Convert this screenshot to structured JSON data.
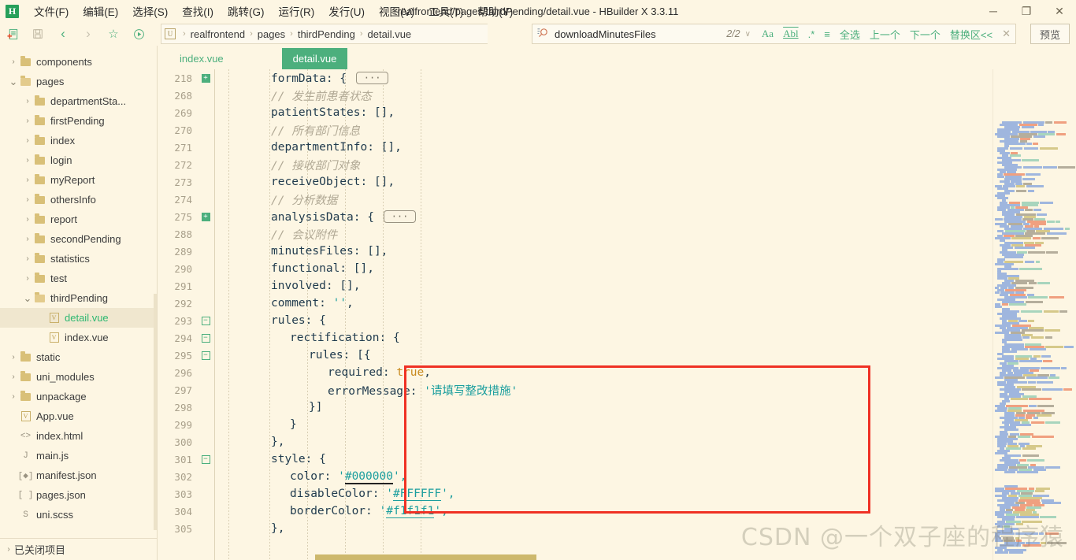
{
  "window": {
    "title": "realfrontend/pages/thirdPending/detail.vue - HBuilder X 3.3.11",
    "logo": "H",
    "minimize": "─",
    "maximize": "❐",
    "close": "✕"
  },
  "menubar": {
    "items": [
      {
        "label": "文件(F)",
        "name": "menu-file"
      },
      {
        "label": "编辑(E)",
        "name": "menu-edit"
      },
      {
        "label": "选择(S)",
        "name": "menu-select"
      },
      {
        "label": "查找(I)",
        "name": "menu-find"
      },
      {
        "label": "跳转(G)",
        "name": "menu-goto"
      },
      {
        "label": "运行(R)",
        "name": "menu-run"
      },
      {
        "label": "发行(U)",
        "name": "menu-publish"
      },
      {
        "label": "视图(V)",
        "name": "menu-view"
      },
      {
        "label": "工具(T)",
        "name": "menu-tools"
      },
      {
        "label": "帮助(Y)",
        "name": "menu-help"
      }
    ]
  },
  "toolbar": {
    "icons": [
      {
        "name": "new-file-icon",
        "glyph": "new"
      },
      {
        "name": "save-icon",
        "glyph": "save"
      },
      {
        "name": "back-arrow-icon",
        "glyph": "‹"
      },
      {
        "name": "forward-arrow-icon",
        "glyph": "›"
      },
      {
        "name": "star-icon",
        "glyph": "☆"
      },
      {
        "name": "run-icon",
        "glyph": "▶"
      }
    ],
    "breadcrumb": {
      "badge": "U",
      "separator": "›",
      "parts": [
        "realfrontend",
        "pages",
        "thirdPending",
        "detail.vue"
      ]
    },
    "preview_label": "预览"
  },
  "search": {
    "icon": "search-icon",
    "value": "downloadMinutesFiles",
    "count": "2/2",
    "chevron": "∨",
    "match_case": "Aa",
    "match_word": "Abl",
    "regex": ".*",
    "in_selection": "≡",
    "select_all": "全选",
    "prev": "上一个",
    "next": "下一个",
    "replace": "替换区<<",
    "close": "✕"
  },
  "sidebar": {
    "items": [
      {
        "label": "components",
        "indent": 1,
        "type": "folder",
        "arrow": "closed",
        "selected": false
      },
      {
        "label": "pages",
        "indent": 1,
        "type": "folder-open",
        "arrow": "open",
        "selected": false
      },
      {
        "label": "departmentSta...",
        "indent": 2,
        "type": "folder",
        "arrow": "closed",
        "selected": false
      },
      {
        "label": "firstPending",
        "indent": 2,
        "type": "folder",
        "arrow": "closed",
        "selected": false
      },
      {
        "label": "index",
        "indent": 2,
        "type": "folder",
        "arrow": "closed",
        "selected": false
      },
      {
        "label": "login",
        "indent": 2,
        "type": "folder",
        "arrow": "closed",
        "selected": false
      },
      {
        "label": "myReport",
        "indent": 2,
        "type": "folder",
        "arrow": "closed",
        "selected": false
      },
      {
        "label": "othersInfo",
        "indent": 2,
        "type": "folder",
        "arrow": "closed",
        "selected": false
      },
      {
        "label": "report",
        "indent": 2,
        "type": "folder",
        "arrow": "closed",
        "selected": false
      },
      {
        "label": "secondPending",
        "indent": 2,
        "type": "folder",
        "arrow": "closed",
        "selected": false
      },
      {
        "label": "statistics",
        "indent": 2,
        "type": "folder",
        "arrow": "closed",
        "selected": false
      },
      {
        "label": "test",
        "indent": 2,
        "type": "folder",
        "arrow": "closed",
        "selected": false
      },
      {
        "label": "thirdPending",
        "indent": 2,
        "type": "folder-open",
        "arrow": "open",
        "selected": false
      },
      {
        "label": "detail.vue",
        "indent": 3,
        "type": "vue",
        "arrow": "none",
        "selected": true,
        "active": true
      },
      {
        "label": "index.vue",
        "indent": 3,
        "type": "vue",
        "arrow": "none",
        "selected": false
      },
      {
        "label": "static",
        "indent": 1,
        "type": "folder",
        "arrow": "closed",
        "selected": false
      },
      {
        "label": "uni_modules",
        "indent": 1,
        "type": "folder",
        "arrow": "closed",
        "selected": false
      },
      {
        "label": "unpackage",
        "indent": 1,
        "type": "folder",
        "arrow": "closed",
        "selected": false
      },
      {
        "label": "App.vue",
        "indent": 1,
        "type": "vue",
        "arrow": "none",
        "selected": false
      },
      {
        "label": "index.html",
        "indent": 1,
        "type": "html",
        "arrow": "none",
        "selected": false
      },
      {
        "label": "main.js",
        "indent": 1,
        "type": "js",
        "arrow": "none",
        "selected": false
      },
      {
        "label": "manifest.json",
        "indent": 1,
        "type": "manifest",
        "arrow": "none",
        "selected": false
      },
      {
        "label": "pages.json",
        "indent": 1,
        "type": "json",
        "arrow": "none",
        "selected": false
      },
      {
        "label": "uni.scss",
        "indent": 1,
        "type": "scss",
        "arrow": "none",
        "selected": false
      }
    ],
    "closed_projects": "已关闭项目",
    "closed_arrow": "›"
  },
  "tabs": [
    {
      "label": "index.vue",
      "active": false
    },
    {
      "label": "detail.vue",
      "active": true
    }
  ],
  "editor": {
    "lines": [
      {
        "num": "218",
        "fold": "plus",
        "indent": 4,
        "parts": [
          {
            "t": "formData: { ",
            "c": "code-txt"
          },
          {
            "t": "···",
            "c": "pill"
          }
        ]
      },
      {
        "num": "268",
        "fold": "",
        "indent": 4,
        "parts": [
          {
            "t": "// 发生前患者状态",
            "c": "cmt"
          }
        ]
      },
      {
        "num": "269",
        "fold": "",
        "indent": 4,
        "parts": [
          {
            "t": "patientStates: [],",
            "c": "code-txt"
          }
        ]
      },
      {
        "num": "270",
        "fold": "",
        "indent": 4,
        "parts": [
          {
            "t": "// 所有部门信息",
            "c": "cmt"
          }
        ]
      },
      {
        "num": "271",
        "fold": "",
        "indent": 4,
        "parts": [
          {
            "t": "departmentInfo: [],",
            "c": "code-txt"
          }
        ]
      },
      {
        "num": "272",
        "fold": "",
        "indent": 4,
        "parts": [
          {
            "t": "// 接收部门对象",
            "c": "cmt"
          }
        ]
      },
      {
        "num": "273",
        "fold": "",
        "indent": 4,
        "parts": [
          {
            "t": "receiveObject: [],",
            "c": "code-txt"
          }
        ]
      },
      {
        "num": "274",
        "fold": "",
        "indent": 4,
        "parts": [
          {
            "t": "// 分析数据",
            "c": "cmt"
          }
        ]
      },
      {
        "num": "275",
        "fold": "plus",
        "indent": 4,
        "parts": [
          {
            "t": "analysisData: { ",
            "c": "code-txt"
          },
          {
            "t": "···",
            "c": "pill"
          }
        ]
      },
      {
        "num": "288",
        "fold": "",
        "indent": 4,
        "parts": [
          {
            "t": "// 会议附件",
            "c": "cmt"
          }
        ]
      },
      {
        "num": "289",
        "fold": "",
        "indent": 4,
        "parts": [
          {
            "t": "minutesFiles: [],",
            "c": "code-txt"
          }
        ]
      },
      {
        "num": "290",
        "fold": "",
        "indent": 4,
        "parts": [
          {
            "t": "functional: [],",
            "c": "code-txt"
          }
        ]
      },
      {
        "num": "291",
        "fold": "",
        "indent": 4,
        "parts": [
          {
            "t": "involved: [],",
            "c": "code-txt"
          }
        ]
      },
      {
        "num": "292",
        "fold": "",
        "indent": 4,
        "parts": [
          {
            "t": "comment: ",
            "c": "code-txt"
          },
          {
            "t": "''",
            "c": "str"
          },
          {
            "t": ",",
            "c": "code-txt"
          }
        ]
      },
      {
        "num": "293",
        "fold": "minus",
        "indent": 4,
        "parts": [
          {
            "t": "rules: {",
            "c": "code-txt"
          }
        ]
      },
      {
        "num": "294",
        "fold": "minus",
        "indent": 5,
        "parts": [
          {
            "t": "rectification: {",
            "c": "code-txt"
          }
        ]
      },
      {
        "num": "295",
        "fold": "minus",
        "indent": 6,
        "parts": [
          {
            "t": "rules: [{",
            "c": "code-txt"
          }
        ]
      },
      {
        "num": "296",
        "fold": "",
        "indent": 7,
        "parts": [
          {
            "t": "required: ",
            "c": "code-txt"
          },
          {
            "t": "true",
            "c": "kw"
          },
          {
            "t": ",",
            "c": "code-txt"
          }
        ]
      },
      {
        "num": "297",
        "fold": "",
        "indent": 7,
        "parts": [
          {
            "t": "errorMessage: ",
            "c": "code-txt"
          },
          {
            "t": "'请填写整改措施'",
            "c": "str"
          }
        ]
      },
      {
        "num": "298",
        "fold": "",
        "indent": 6,
        "parts": [
          {
            "t": "}]",
            "c": "code-txt"
          }
        ]
      },
      {
        "num": "299",
        "fold": "",
        "indent": 5,
        "parts": [
          {
            "t": "}",
            "c": "code-txt"
          }
        ]
      },
      {
        "num": "300",
        "fold": "",
        "indent": 4,
        "parts": [
          {
            "t": "},",
            "c": "code-txt"
          }
        ]
      },
      {
        "num": "301",
        "fold": "minus",
        "indent": 4,
        "parts": [
          {
            "t": "style: {",
            "c": "code-txt"
          }
        ]
      },
      {
        "num": "302",
        "fold": "",
        "indent": 5,
        "parts": [
          {
            "t": "color: ",
            "c": "code-txt"
          },
          {
            "t": "'",
            "c": "str"
          },
          {
            "t": "#000000",
            "c": "str ul-dark"
          },
          {
            "t": "',",
            "c": "str"
          }
        ]
      },
      {
        "num": "303",
        "fold": "",
        "indent": 5,
        "parts": [
          {
            "t": "disableColor: ",
            "c": "code-txt"
          },
          {
            "t": "'",
            "c": "str"
          },
          {
            "t": "#FFFFFF",
            "c": "str ul"
          },
          {
            "t": "',",
            "c": "str"
          }
        ]
      },
      {
        "num": "304",
        "fold": "",
        "indent": 5,
        "parts": [
          {
            "t": "borderColor: ",
            "c": "code-txt"
          },
          {
            "t": "'",
            "c": "str"
          },
          {
            "t": "#f1f1f1",
            "c": "str ul"
          },
          {
            "t": "',",
            "c": "str"
          }
        ]
      },
      {
        "num": "305",
        "fold": "",
        "indent": 4,
        "parts": [
          {
            "t": "},",
            "c": "code-txt"
          }
        ]
      }
    ],
    "highlight_color": "#ef3124"
  },
  "watermark": "CSDN @一个双子座的程序猿",
  "colors": {
    "background": "#fdf6e3",
    "accent_green": "#4caf7d",
    "highlight_red": "#ef3124",
    "comment_gray": "#b0a894",
    "string_teal": "#1b9e9e",
    "keyword_orange": "#c88a1e"
  }
}
